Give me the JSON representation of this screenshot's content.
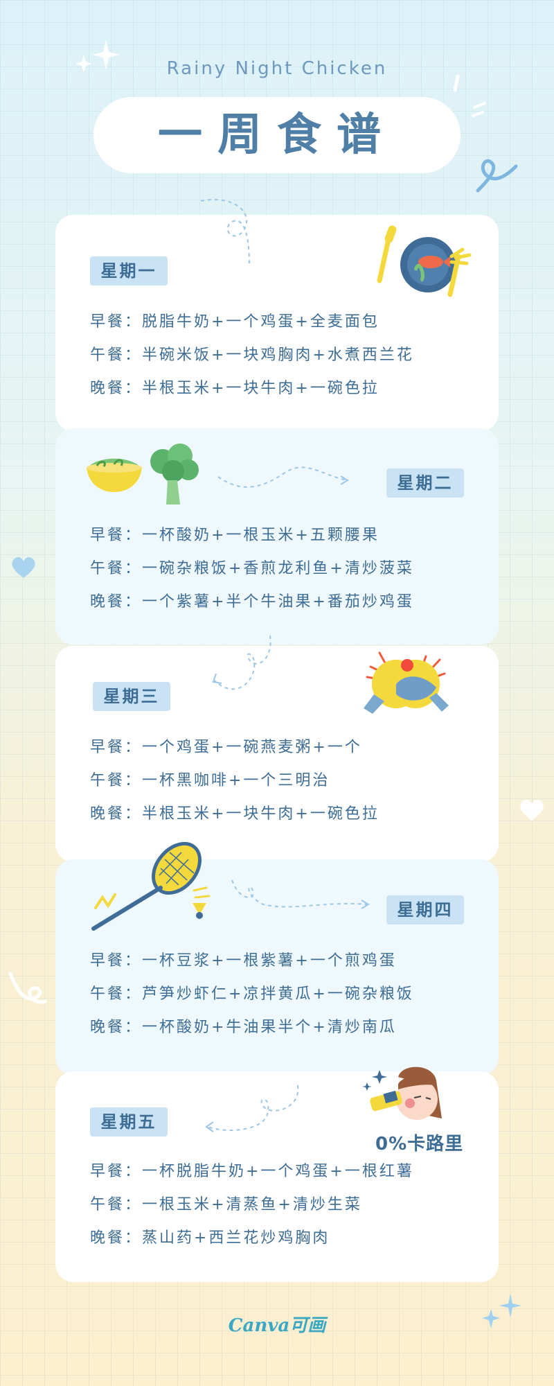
{
  "header": {
    "subtitle": "Rainy Night Chicken",
    "title": "一周食谱"
  },
  "days": [
    {
      "name": "星期一",
      "meals": [
        "早餐：脱脂牛奶+一个鸡蛋+全麦面包",
        "午餐：半碗米饭+一块鸡胸肉+水煮西兰花",
        "晚餐：半根玉米+一块牛肉+一碗色拉"
      ]
    },
    {
      "name": "星期二",
      "meals": [
        "早餐：一杯酸奶+一根玉米+五颗腰果",
        "午餐：一碗杂粮饭+香煎龙利鱼+清炒菠菜",
        "晚餐：一个紫薯+半个牛油果+番茄炒鸡蛋"
      ]
    },
    {
      "name": "星期三",
      "meals": [
        "早餐：一个鸡蛋+一碗燕麦粥+一个",
        "午餐：一杯黑咖啡+一个三明治",
        "晚餐：半根玉米+一块牛肉+一碗色拉"
      ]
    },
    {
      "name": "星期四",
      "meals": [
        "早餐：一杯豆浆+一根紫薯+一个煎鸡蛋",
        "午餐：芦笋炒虾仁+凉拌黄瓜+一碗杂粮饭",
        "晚餐：一杯酸奶+牛油果半个+清炒南瓜"
      ]
    },
    {
      "name": "星期五",
      "meals": [
        "早餐：一杯脱脂牛奶+一个鸡蛋+一根红薯",
        "午餐：一根玉米+清蒸鱼+清炒生菜",
        "晚餐：蒸山药+西兰花炒鸡胸肉"
      ]
    }
  ],
  "badge": {
    "calories": "0%卡路里"
  },
  "footer": {
    "brand": "Canva可画"
  },
  "colors": {
    "accent": "#4f7ea6",
    "tag": "#c9e3f4",
    "card_blue": "#eff9fd"
  }
}
